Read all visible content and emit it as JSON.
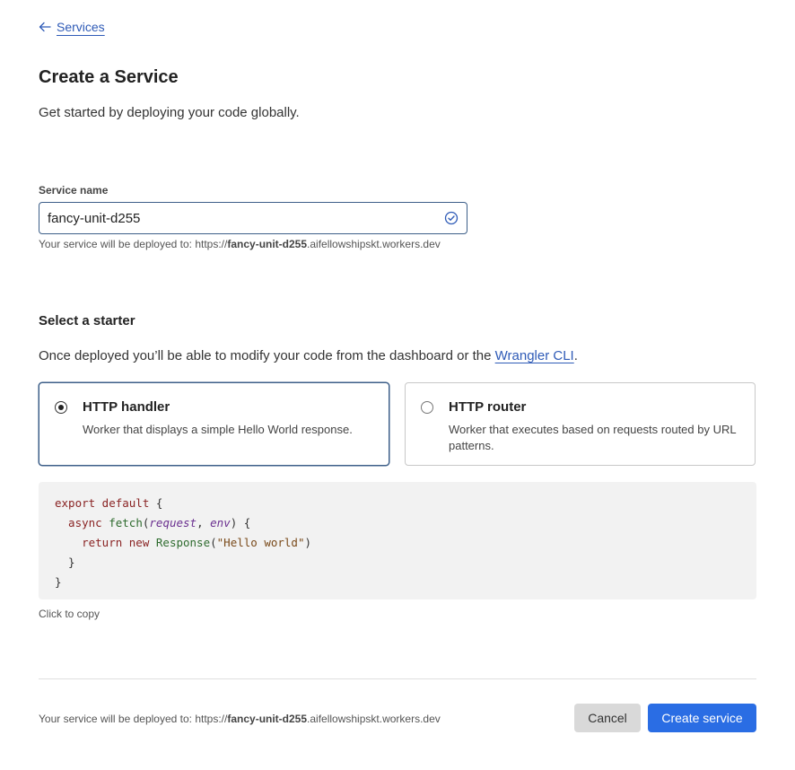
{
  "nav": {
    "back_label": "Services"
  },
  "page": {
    "title": "Create a Service",
    "subtitle": "Get started by deploying your code globally."
  },
  "service_name": {
    "label": "Service name",
    "value": "fancy-unit-d255",
    "deploy_prefix": "Your service will be deployed to: https://",
    "deploy_name": "fancy-unit-d255",
    "deploy_domain": ".aifellowshipskt.workers.dev"
  },
  "starter": {
    "title": "Select a starter",
    "desc_prefix": "Once deployed you’ll be able to modify your code from the dashboard or the ",
    "desc_link": "Wrangler CLI",
    "desc_suffix": ".",
    "options": [
      {
        "title": "HTTP handler",
        "desc": "Worker that displays a simple Hello World response.",
        "selected": true
      },
      {
        "title": "HTTP router",
        "desc": "Worker that executes based on requests routed by URL patterns.",
        "selected": false
      }
    ]
  },
  "code": {
    "lines": [
      [
        {
          "t": "export default ",
          "c": "kw"
        },
        {
          "t": "{",
          "c": "plain"
        }
      ],
      [
        {
          "t": "  async ",
          "c": "kw"
        },
        {
          "t": "fetch",
          "c": "fn"
        },
        {
          "t": "(",
          "c": "plain"
        },
        {
          "t": "request",
          "c": "param"
        },
        {
          "t": ", ",
          "c": "plain"
        },
        {
          "t": "env",
          "c": "param"
        },
        {
          "t": ") {",
          "c": "plain"
        }
      ],
      [
        {
          "t": "    return new ",
          "c": "kw"
        },
        {
          "t": "Response",
          "c": "fn"
        },
        {
          "t": "(",
          "c": "plain"
        },
        {
          "t": "\"Hello world\"",
          "c": "str"
        },
        {
          "t": ")",
          "c": "plain"
        }
      ],
      [
        {
          "t": "  }",
          "c": "plain"
        }
      ],
      [
        {
          "t": "}",
          "c": "plain"
        }
      ]
    ],
    "copy_hint": "Click to copy"
  },
  "footer": {
    "deploy_prefix": "Your service will be deployed to: https://",
    "deploy_name": "fancy-unit-d255",
    "deploy_domain": ".aifellowshipskt.workers.dev",
    "cancel_label": "Cancel",
    "create_label": "Create service"
  },
  "colors": {
    "primary": "#2a6de4",
    "link": "#2f5bb7",
    "selected_border": "#3d5f89",
    "code_bg": "#f2f2f2"
  }
}
